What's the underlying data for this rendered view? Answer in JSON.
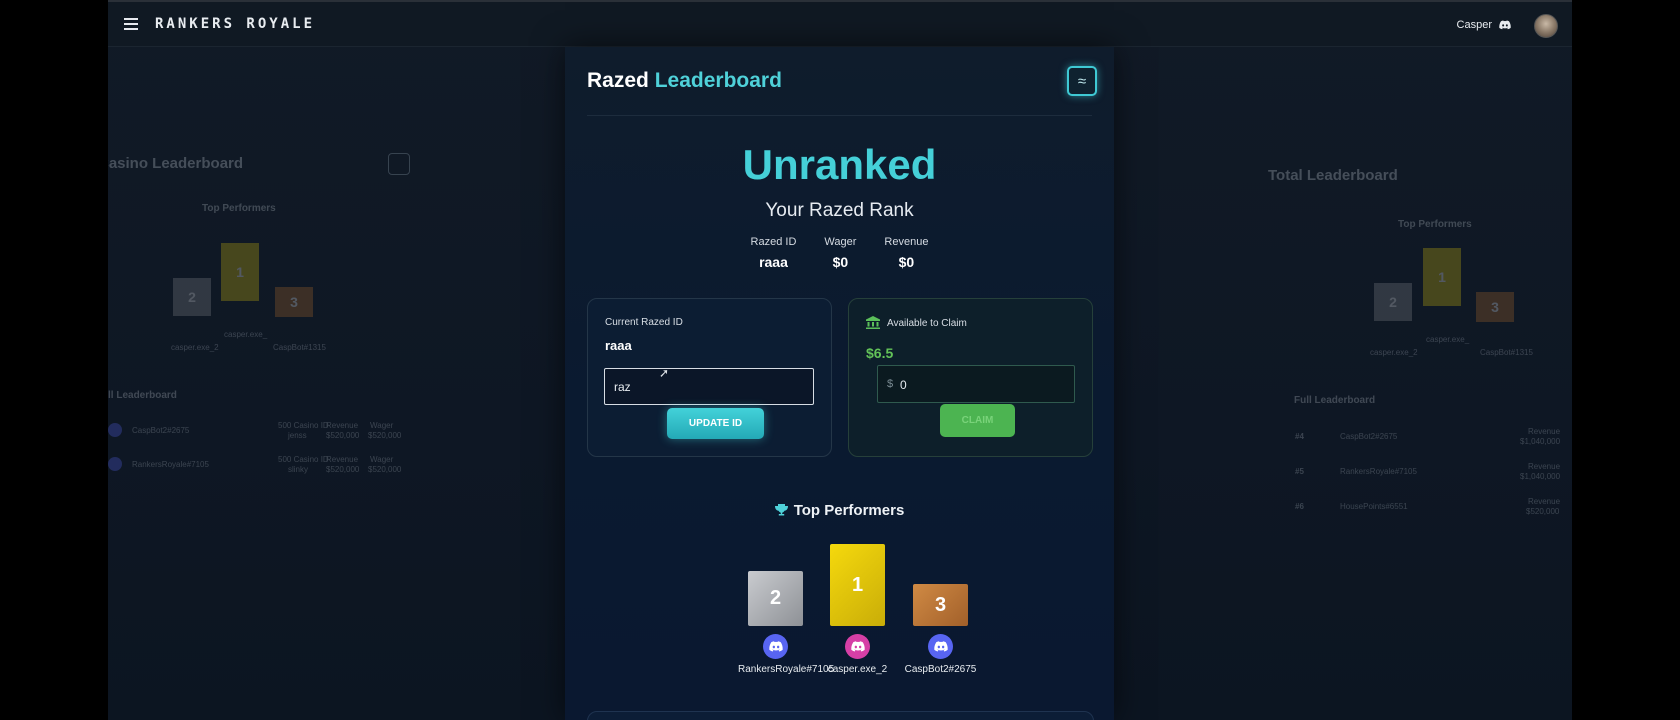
{
  "topbar": {
    "brand": "RANKERS ROYALE",
    "user_name": "Casper"
  },
  "left_panel": {
    "title": "Casino Leaderboard",
    "top_performers_label": "Top Performers",
    "podium": [
      {
        "rank": "2",
        "name": "casper.exe_2"
      },
      {
        "rank": "1",
        "name": "casper.exe_"
      },
      {
        "rank": "3",
        "name": "CaspBot#1315"
      }
    ],
    "full_label": "ll Leaderboard",
    "rows": [
      {
        "name": "CaspBot2#2675",
        "id_label": "500 Casino ID",
        "id": "jenss",
        "rev_label": "Revenue",
        "rev": "$520,000",
        "wag_label": "Wager",
        "wag": "$520,000"
      },
      {
        "name": "RankersRoyale#7105",
        "id_label": "500 Casino ID",
        "id": "slinky",
        "rev_label": "Revenue",
        "rev": "$520,000",
        "wag_label": "Wager",
        "wag": "$520,000"
      }
    ]
  },
  "right_panel": {
    "title": "Total Leaderboard",
    "top_performers_label": "Top Performers",
    "podium": [
      {
        "rank": "2",
        "name": "casper.exe_2"
      },
      {
        "rank": "1",
        "name": "casper.exe_"
      },
      {
        "rank": "3",
        "name": "CaspBot#1315"
      }
    ],
    "full_label": "Full Leaderboard",
    "rows": [
      {
        "rank": "#4",
        "name": "CaspBot2#2675",
        "rev_label": "Revenue",
        "rev": "$1,040,000"
      },
      {
        "rank": "#5",
        "name": "RankersRoyale#7105",
        "rev_label": "Revenue",
        "rev": "$1,040,000"
      },
      {
        "rank": "#6",
        "name": "HousePoints#6551",
        "rev_label": "Revenue",
        "rev": "$520,000"
      }
    ]
  },
  "main": {
    "title_prefix": "Razed",
    "title_accent": "Leaderboard",
    "wave_icon": "≈",
    "rank": "Unranked",
    "rank_subtitle": "Your Razed Rank",
    "stats": [
      {
        "label": "Razed ID",
        "value": "raaa"
      },
      {
        "label": "Wager",
        "value": "$0"
      },
      {
        "label": "Revenue",
        "value": "$0"
      }
    ],
    "id_card": {
      "label": "Current Razed ID",
      "value": "raaa",
      "input_value": "raz",
      "button": "UPDATE ID"
    },
    "claim_card": {
      "label": "Available to Claim",
      "amount": "$6.5",
      "currency": "$",
      "input_value": "0",
      "button": "CLAIM"
    },
    "top_performers": {
      "label": "Top Performers",
      "podium": [
        {
          "rank": "2",
          "name": "RankersRoyale#7105"
        },
        {
          "rank": "1",
          "name": "casper.exe_2"
        },
        {
          "rank": "3",
          "name": "CaspBot2#2675"
        }
      ]
    }
  },
  "colors": {
    "accent": "#45d0d8",
    "claim_green": "#62c258",
    "gold": "#e6c80f",
    "silver": "#b4b6ba",
    "bronze": "#c17a3a",
    "discord_blue": "#5865f2",
    "discord_pink": "#d63fa6"
  }
}
